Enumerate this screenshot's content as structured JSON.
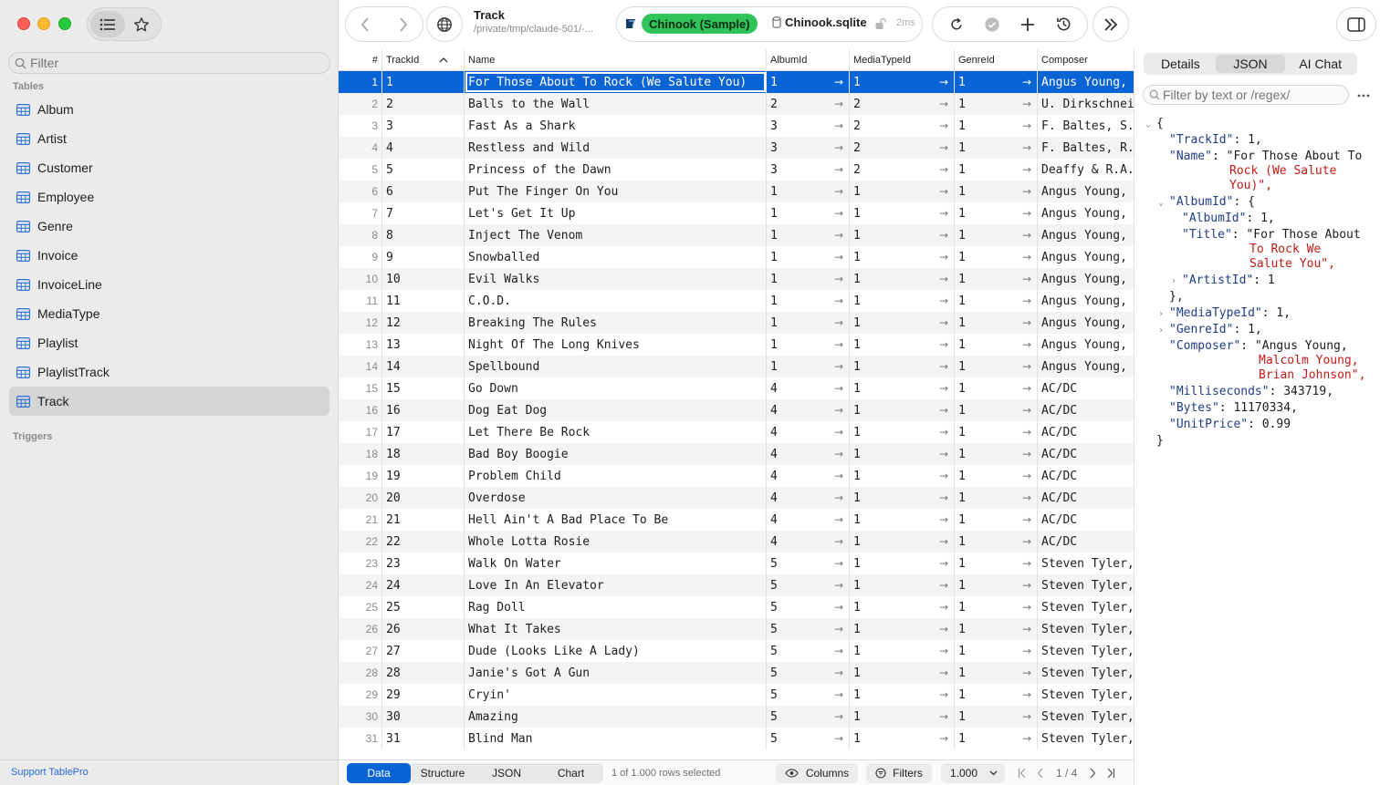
{
  "sidebar": {
    "filter_placeholder": "Filter",
    "tables_heading": "Tables",
    "tables": [
      "Album",
      "Artist",
      "Customer",
      "Employee",
      "Genre",
      "Invoice",
      "InvoiceLine",
      "MediaType",
      "Playlist",
      "PlaylistTrack",
      "Track"
    ],
    "active_table": "Track",
    "triggers_heading": "Triggers",
    "support_link": "Support TablePro"
  },
  "toolbar": {
    "title": "Track",
    "path": "/private/tmp/claude-501/-...",
    "connection_name": "Chinook (Sample)",
    "database_file": "Chinook.sqlite",
    "latency": "2ms"
  },
  "grid": {
    "columns": [
      "#",
      "TrackId",
      "Name",
      "AlbumId",
      "MediaTypeId",
      "GenreId",
      "Composer"
    ],
    "sort_column": "TrackId",
    "selected_row": 1,
    "rows": [
      {
        "n": "1",
        "id": "1",
        "name": "For Those About To Rock (We Salute You)",
        "album": "1",
        "media": "1",
        "genre": "1",
        "composer": "Angus Young, Malcolm Young, Brian Johnson"
      },
      {
        "n": "2",
        "id": "2",
        "name": "Balls to the Wall",
        "album": "2",
        "media": "2",
        "genre": "1",
        "composer": "U. Dirkschneider, W. Hoffmann"
      },
      {
        "n": "3",
        "id": "3",
        "name": "Fast As a Shark",
        "album": "3",
        "media": "2",
        "genre": "1",
        "composer": "F. Baltes, S. Kaufman, U. Dirkscneider & W. Hoffman"
      },
      {
        "n": "4",
        "id": "4",
        "name": "Restless and Wild",
        "album": "3",
        "media": "2",
        "genre": "1",
        "composer": "F. Baltes, R.A. Smith-Diesel, S. Kaufman"
      },
      {
        "n": "5",
        "id": "5",
        "name": "Princess of the Dawn",
        "album": "3",
        "media": "2",
        "genre": "1",
        "composer": "Deaffy & R.A. Smith-Diesel"
      },
      {
        "n": "6",
        "id": "6",
        "name": "Put The Finger On You",
        "album": "1",
        "media": "1",
        "genre": "1",
        "composer": "Angus Young, Malcolm Young, Brian Johnson"
      },
      {
        "n": "7",
        "id": "7",
        "name": "Let's Get It Up",
        "album": "1",
        "media": "1",
        "genre": "1",
        "composer": "Angus Young, Malcolm Young, Brian Johnson"
      },
      {
        "n": "8",
        "id": "8",
        "name": "Inject The Venom",
        "album": "1",
        "media": "1",
        "genre": "1",
        "composer": "Angus Young, Malcolm Young, Brian Johnson"
      },
      {
        "n": "9",
        "id": "9",
        "name": "Snowballed",
        "album": "1",
        "media": "1",
        "genre": "1",
        "composer": "Angus Young, Malcolm Young, Brian Johnson"
      },
      {
        "n": "10",
        "id": "10",
        "name": "Evil Walks",
        "album": "1",
        "media": "1",
        "genre": "1",
        "composer": "Angus Young, Malcolm Young, Brian Johnson"
      },
      {
        "n": "11",
        "id": "11",
        "name": "C.O.D.",
        "album": "1",
        "media": "1",
        "genre": "1",
        "composer": "Angus Young, Malcolm Young, Brian Johnson"
      },
      {
        "n": "12",
        "id": "12",
        "name": "Breaking The Rules",
        "album": "1",
        "media": "1",
        "genre": "1",
        "composer": "Angus Young, Malcolm Young, Brian Johnson"
      },
      {
        "n": "13",
        "id": "13",
        "name": "Night Of The Long Knives",
        "album": "1",
        "media": "1",
        "genre": "1",
        "composer": "Angus Young, Malcolm Young, Brian Johnson"
      },
      {
        "n": "14",
        "id": "14",
        "name": "Spellbound",
        "album": "1",
        "media": "1",
        "genre": "1",
        "composer": "Angus Young, Malcolm Young, Brian Johnson"
      },
      {
        "n": "15",
        "id": "15",
        "name": "Go Down",
        "album": "4",
        "media": "1",
        "genre": "1",
        "composer": "AC/DC"
      },
      {
        "n": "16",
        "id": "16",
        "name": "Dog Eat Dog",
        "album": "4",
        "media": "1",
        "genre": "1",
        "composer": "AC/DC"
      },
      {
        "n": "17",
        "id": "17",
        "name": "Let There Be Rock",
        "album": "4",
        "media": "1",
        "genre": "1",
        "composer": "AC/DC"
      },
      {
        "n": "18",
        "id": "18",
        "name": "Bad Boy Boogie",
        "album": "4",
        "media": "1",
        "genre": "1",
        "composer": "AC/DC"
      },
      {
        "n": "19",
        "id": "19",
        "name": "Problem Child",
        "album": "4",
        "media": "1",
        "genre": "1",
        "composer": "AC/DC"
      },
      {
        "n": "20",
        "id": "20",
        "name": "Overdose",
        "album": "4",
        "media": "1",
        "genre": "1",
        "composer": "AC/DC"
      },
      {
        "n": "21",
        "id": "21",
        "name": "Hell Ain't A Bad Place To Be",
        "album": "4",
        "media": "1",
        "genre": "1",
        "composer": "AC/DC"
      },
      {
        "n": "22",
        "id": "22",
        "name": "Whole Lotta Rosie",
        "album": "4",
        "media": "1",
        "genre": "1",
        "composer": "AC/DC"
      },
      {
        "n": "23",
        "id": "23",
        "name": "Walk On Water",
        "album": "5",
        "media": "1",
        "genre": "1",
        "composer": "Steven Tyler, Joe Perry, Jack Blades, Tommy Shaw"
      },
      {
        "n": "24",
        "id": "24",
        "name": "Love In An Elevator",
        "album": "5",
        "media": "1",
        "genre": "1",
        "composer": "Steven Tyler, Joe Perry"
      },
      {
        "n": "25",
        "id": "25",
        "name": "Rag Doll",
        "album": "5",
        "media": "1",
        "genre": "1",
        "composer": "Steven Tyler, Joe Perry, Jim Vallance, Holly Knight"
      },
      {
        "n": "26",
        "id": "26",
        "name": "What It Takes",
        "album": "5",
        "media": "1",
        "genre": "1",
        "composer": "Steven Tyler, Joe Perry, Desmond Child"
      },
      {
        "n": "27",
        "id": "27",
        "name": "Dude (Looks Like A Lady)",
        "album": "5",
        "media": "1",
        "genre": "1",
        "composer": "Steven Tyler, Joe Perry, Desmond Child"
      },
      {
        "n": "28",
        "id": "28",
        "name": "Janie's Got A Gun",
        "album": "5",
        "media": "1",
        "genre": "1",
        "composer": "Steven Tyler, Tom Hamilton"
      },
      {
        "n": "29",
        "id": "29",
        "name": "Cryin'",
        "album": "5",
        "media": "1",
        "genre": "1",
        "composer": "Steven Tyler, Joe Perry, Taylor Rhodes"
      },
      {
        "n": "30",
        "id": "30",
        "name": "Amazing",
        "album": "5",
        "media": "1",
        "genre": "1",
        "composer": "Steven Tyler, Richie Supa"
      },
      {
        "n": "31",
        "id": "31",
        "name": "Blind Man",
        "album": "5",
        "media": "1",
        "genre": "1",
        "composer": "Steven Tyler, Joe Perry, Taylor Rhodes"
      }
    ]
  },
  "footer": {
    "tabs": [
      "Data",
      "Structure",
      "JSON",
      "Chart"
    ],
    "active_tab": "Data",
    "row_status": "1 of 1.000 rows selected",
    "columns_label": "Columns",
    "filters_label": "Filters",
    "page_size": "1.000",
    "page_indicator": "1 / 4"
  },
  "right_panel": {
    "tabs": [
      "Details",
      "JSON",
      "AI Chat"
    ],
    "active_tab": "JSON",
    "filter_placeholder": "Filter by text or /regex/",
    "json_lines": [
      "{",
      "\"TrackId\": 1,",
      "\"Name\": \"For Those About To",
      "Rock (We Salute",
      "You)\",",
      "\"AlbumId\": {",
      "\"AlbumId\": 1,",
      "\"Title\": \"For Those About",
      "To Rock We",
      "Salute You\",",
      "\"ArtistId\": 1",
      "},",
      "\"MediaTypeId\": 1,",
      "\"GenreId\": 1,",
      "\"Composer\": \"Angus Young,",
      "Malcolm Young,",
      "Brian Johnson\",",
      "\"Milliseconds\": 343719,",
      "\"Bytes\": 11170334,",
      "\"UnitPrice\": 0.99",
      "}"
    ]
  },
  "colors": {
    "accent": "#0a64d6",
    "connection_badge": "#30c45b",
    "json_key": "#1f3d8a",
    "json_string": "#c41a16",
    "json_number": "#1c00cf"
  }
}
